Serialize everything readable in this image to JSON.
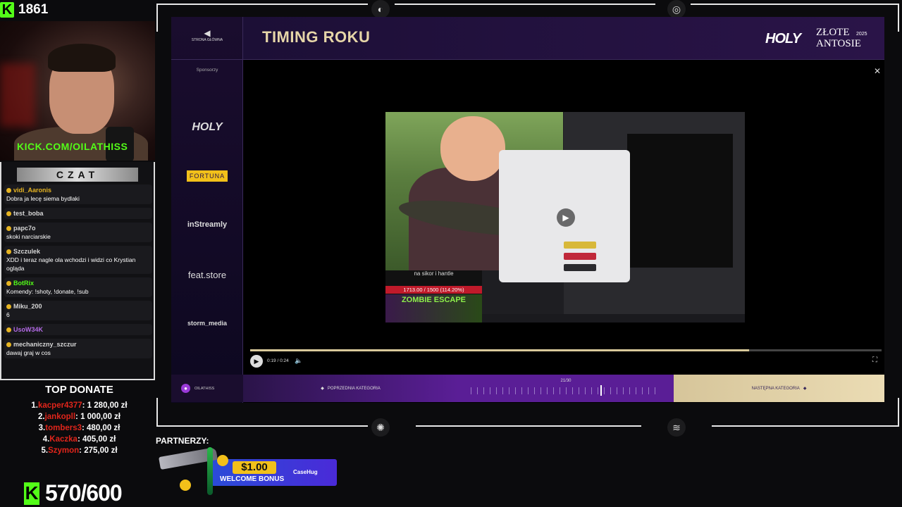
{
  "stream": {
    "viewer_count": "1861",
    "channel_url": "KICK.COM/OILATHISS",
    "chat_title": "CZAT",
    "sub_goal": "570/600",
    "partners_label": "PARTNERZY:",
    "promo_amount": "$1.00",
    "promo_text": "WELCOME BONUS",
    "promo_brand": "CaseHug"
  },
  "chat": [
    {
      "user": "vidi_Aaronis",
      "text": "Dobra ja lecę siema bydlaki",
      "color": "#e6b422"
    },
    {
      "user": "test_boba",
      "text": "",
      "color": "#d7d7d7"
    },
    {
      "user": "papc7o",
      "text": "skoki narciarskie",
      "color": "#d7d7d7"
    },
    {
      "user": "Szczulek",
      "text": "XDD i teraz nagle ola wchodzi i widzi co Krystian ogląda",
      "color": "#d7d7d7"
    },
    {
      "user": "BotRix",
      "text": "Komendy: !shoty, !donate, !sub",
      "color": "#53fc18"
    },
    {
      "user": "Miku_200",
      "text": "6",
      "color": "#d7d7d7"
    },
    {
      "user": "UsoW34K",
      "text": "",
      "color": "#b36ae6"
    },
    {
      "user": "mechaniczny_szczur",
      "text": "dawaj graj w cos",
      "color": "#d7d7d7"
    }
  ],
  "top_donate": {
    "title": "TOP DONATE",
    "entries": [
      {
        "rank": "1.",
        "name": "kacper4377",
        "amount": ": 1 280,00 zł"
      },
      {
        "rank": "2.",
        "name": "jankopll",
        "amount": ": 1 000,00 zł"
      },
      {
        "rank": "3.",
        "name": "tombers3",
        "amount": ": 480,00 zł"
      },
      {
        "rank": "4.",
        "name": "Kaczka",
        "amount": ": 405,00 zł"
      },
      {
        "rank": "5.",
        "name": "Szymon",
        "amount": ": 275,00 zł"
      }
    ]
  },
  "app": {
    "back_label": "STRONA GŁÓWNA",
    "title": "TIMING ROKU",
    "brand": "HOLY",
    "event_name_1": "ZŁOTE",
    "event_name_2": "ANTOSIE",
    "event_year": "2025",
    "sponsors_label": "Sponsorzy",
    "sponsors": [
      "HOLY",
      "FORTUNA",
      "inStreamly",
      "feat.store",
      "storm_media"
    ],
    "close_icon": "close-icon"
  },
  "video": {
    "overlay_text": "na sikor i hantle",
    "overlay_progress": "1713.00 / 1500 (114.20%)",
    "game_title": "ZOMBIE ESCAPE",
    "current_time": "0:19 / 0:24",
    "progress_fraction": 0.79
  },
  "nav": {
    "user_name": "OILATHISS",
    "prev_label": "POPRZEDNIA KATEGORIA",
    "next_label": "NASTĘPNA KATEGORIA",
    "position": "21/30"
  }
}
